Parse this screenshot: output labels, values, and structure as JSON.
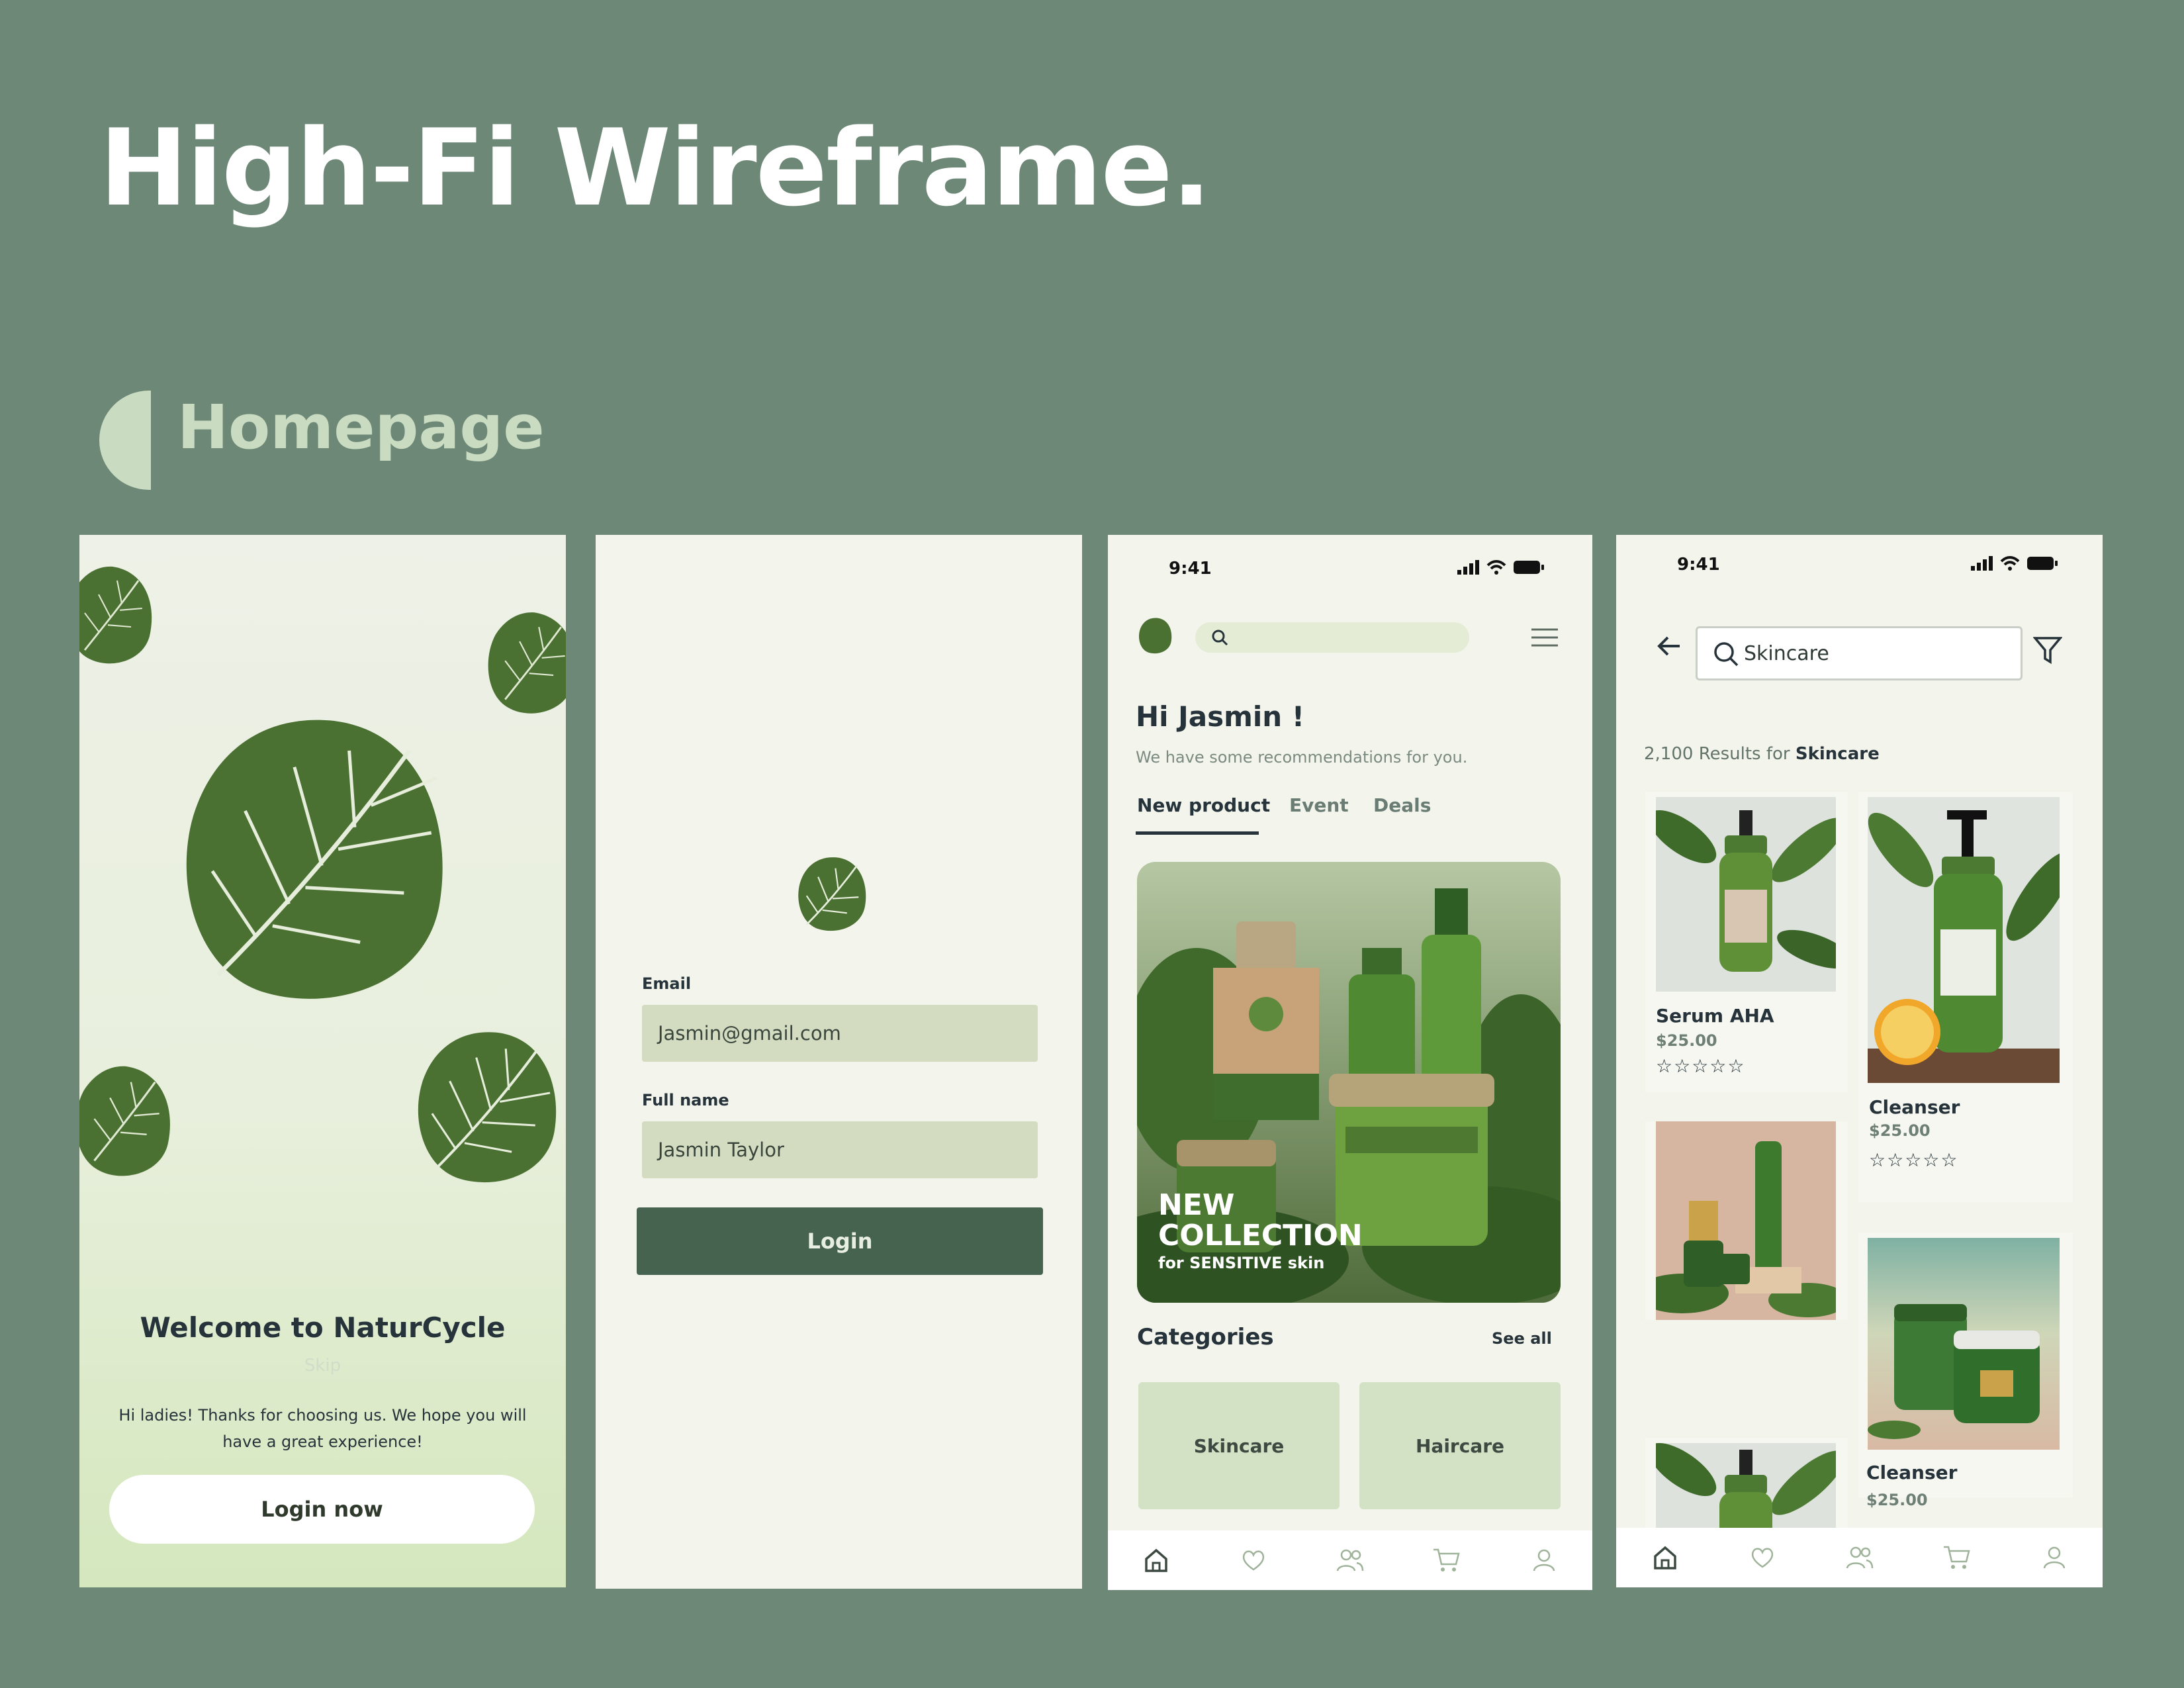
{
  "header": {
    "title": "High-Fi Wireframe.",
    "section": "Homepage"
  },
  "welcome_screen": {
    "title": "Welcome to NaturCycle",
    "skip": "Skip",
    "message": "Hi ladies! Thanks for choosing us. We hope you will have a great experience!",
    "button": "Login now"
  },
  "login_screen": {
    "email_label": "Email",
    "email_value": "Jasmin@gmail.com",
    "name_label": "Full name",
    "name_value": "Jasmin Taylor",
    "button": "Login"
  },
  "home_screen": {
    "time": "9:41",
    "greeting": "Hi Jasmin !",
    "subtitle": "We have some recommendations for you.",
    "tabs": [
      "New product",
      "Event",
      "Deals"
    ],
    "hero": {
      "line1": "NEW",
      "line2": "COLLECTION",
      "sub": "for SENSITIVE skin"
    },
    "categories_title": "Categories",
    "see_all": "See all",
    "categories": [
      "Skincare",
      "Haircare"
    ]
  },
  "search_screen": {
    "time": "9:41",
    "query": "Skincare",
    "results_prefix": "2,100 Results for",
    "results_term": "Skincare",
    "products": [
      {
        "name": "Serum AHA",
        "price": "$25.00",
        "rating": 0
      },
      {
        "name": "Cleanser",
        "price": "$25.00",
        "rating": 0
      },
      {
        "name": "Cleanser",
        "price": "$25.00",
        "rating": 0
      }
    ],
    "stars": "☆☆☆☆☆"
  },
  "nav_icons": [
    "home-icon",
    "heart-icon",
    "community-icon",
    "cart-icon",
    "profile-icon"
  ],
  "colors": {
    "background": "#6e8878",
    "leaf": "#4a7032",
    "primary_button": "#46634f",
    "field": "#d3dbc1",
    "accent_light": "#c9dbc0"
  }
}
